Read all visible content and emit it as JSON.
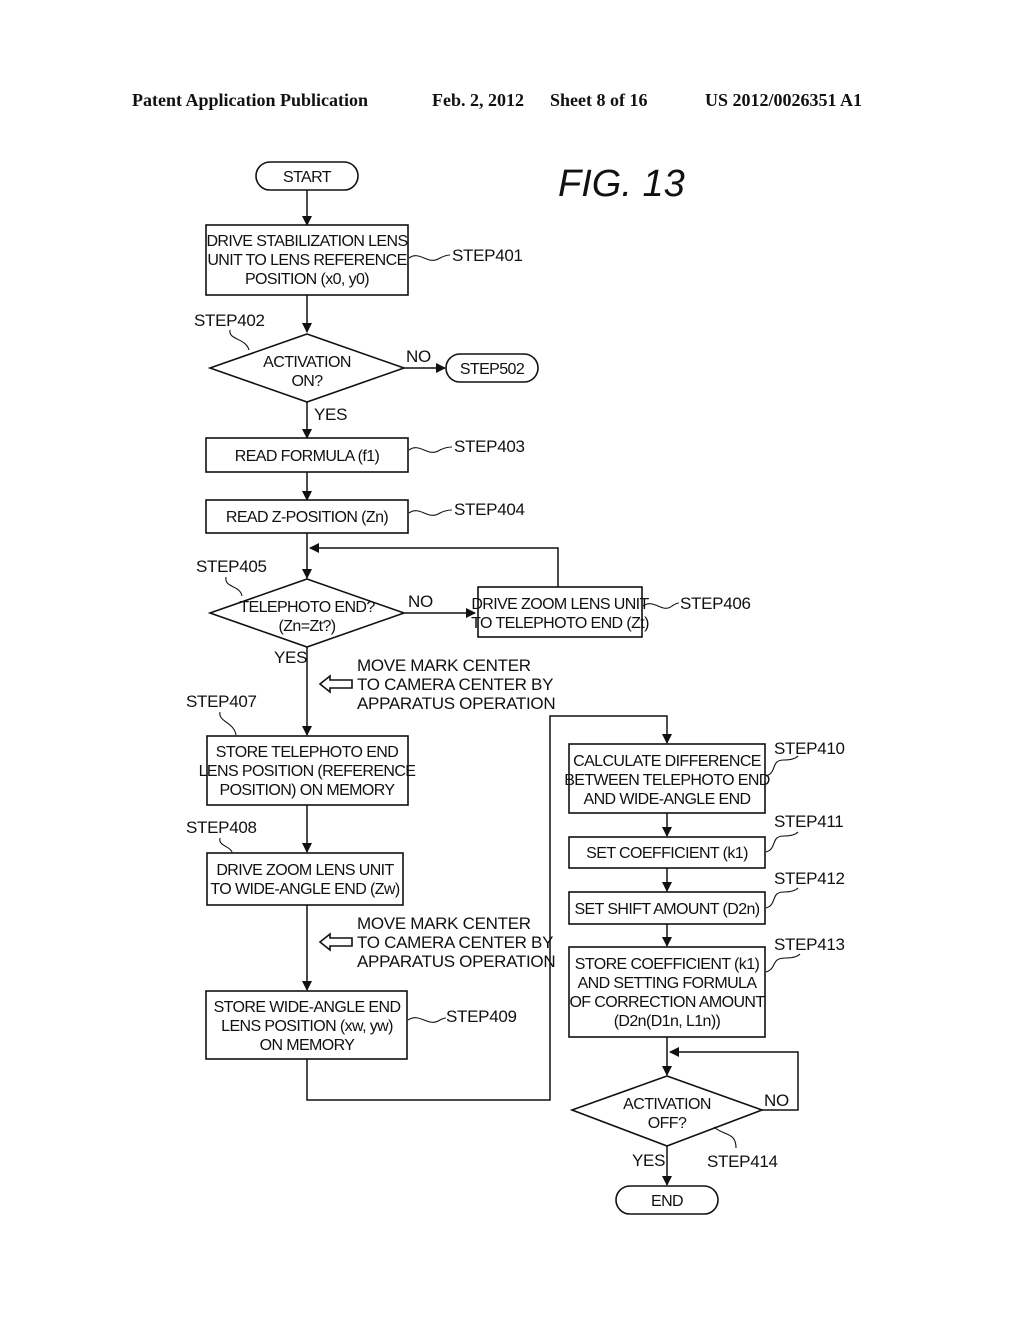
{
  "header": {
    "publication": "Patent Application Publication",
    "date": "Feb. 2, 2012",
    "sheet": "Sheet 8 of 16",
    "number": "US 2012/0026351 A1"
  },
  "figure": {
    "title": "FIG.  13"
  },
  "nodes": {
    "start": {
      "type": "terminal",
      "lines": [
        "START"
      ]
    },
    "s401": {
      "type": "process",
      "step": "STEP401",
      "lines": [
        "DRIVE STABILIZATION LENS",
        "UNIT TO LENS REFERENCE",
        "POSITION (x0, y0)"
      ]
    },
    "s402": {
      "type": "decision",
      "step": "STEP402",
      "lines": [
        "ACTIVATION",
        "ON?"
      ]
    },
    "s502": {
      "type": "terminal",
      "lines": [
        "STEP502"
      ]
    },
    "s403": {
      "type": "process",
      "step": "STEP403",
      "lines": [
        "READ FORMULA (f1)"
      ]
    },
    "s404": {
      "type": "process",
      "step": "STEP404",
      "lines": [
        "READ Z-POSITION (Zn)"
      ]
    },
    "s405": {
      "type": "decision",
      "step": "STEP405",
      "lines": [
        "TELEPHOTO END?",
        "(Zn=Zt?)"
      ]
    },
    "s406": {
      "type": "process",
      "step": "STEP406",
      "lines": [
        "DRIVE ZOOM LENS UNIT",
        "TO TELEPHOTO END (Zt)"
      ]
    },
    "s407": {
      "type": "process",
      "step": "STEP407",
      "lines": [
        "STORE TELEPHOTO END",
        "LENS POSITION (REFERENCE",
        "POSITION) ON MEMORY"
      ]
    },
    "s408": {
      "type": "process",
      "step": "STEP408",
      "lines": [
        "DRIVE ZOOM LENS UNIT",
        "TO WIDE-ANGLE END (Zw)"
      ]
    },
    "s409": {
      "type": "process",
      "step": "STEP409",
      "lines": [
        "STORE WIDE-ANGLE END",
        "LENS POSITION (xw, yw)",
        "ON MEMORY"
      ]
    },
    "s410": {
      "type": "process",
      "step": "STEP410",
      "lines": [
        "CALCULATE DIFFERENCE",
        "BETWEEN TELEPHOTO END",
        "AND WIDE-ANGLE END"
      ]
    },
    "s411": {
      "type": "process",
      "step": "STEP411",
      "lines": [
        "SET COEFFICIENT (k1)"
      ]
    },
    "s412": {
      "type": "process",
      "step": "STEP412",
      "lines": [
        "SET SHIFT AMOUNT (D2n)"
      ]
    },
    "s413": {
      "type": "process",
      "step": "STEP413",
      "lines": [
        "STORE COEFFICIENT (k1)",
        "AND SETTING FORMULA",
        "OF CORRECTION AMOUNT",
        "(D2n(D1n, L1n))"
      ]
    },
    "s414": {
      "type": "decision",
      "step": "STEP414",
      "lines": [
        "ACTIVATION",
        "OFF?"
      ]
    },
    "end": {
      "type": "terminal",
      "lines": [
        "END"
      ]
    }
  },
  "branch_labels": {
    "s402_no": "NO",
    "s402_yes": "YES",
    "s405_no": "NO",
    "s405_yes": "YES",
    "s414_no": "NO",
    "s414_yes": "YES"
  },
  "notes": {
    "note1": [
      "MOVE MARK CENTER",
      "TO CAMERA CENTER BY",
      "APPARATUS OPERATION"
    ],
    "note2": [
      "MOVE MARK CENTER",
      "TO CAMERA CENTER BY",
      "APPARATUS OPERATION"
    ]
  },
  "edges": [
    {
      "from": "start",
      "to": "s401"
    },
    {
      "from": "s401",
      "to": "s402"
    },
    {
      "from": "s402",
      "to": "s502",
      "label": "NO"
    },
    {
      "from": "s402",
      "to": "s403",
      "label": "YES"
    },
    {
      "from": "s403",
      "to": "s404"
    },
    {
      "from": "s404",
      "to": "s405"
    },
    {
      "from": "s405",
      "to": "s406",
      "label": "NO"
    },
    {
      "from": "s406",
      "to": "s405"
    },
    {
      "from": "s405",
      "to": "s407",
      "label": "YES"
    },
    {
      "from": "s407",
      "to": "s408"
    },
    {
      "from": "s408",
      "to": "s409"
    },
    {
      "from": "s409",
      "to": "s410"
    },
    {
      "from": "s410",
      "to": "s411"
    },
    {
      "from": "s411",
      "to": "s412"
    },
    {
      "from": "s412",
      "to": "s413"
    },
    {
      "from": "s413",
      "to": "s414"
    },
    {
      "from": "s414",
      "to": "s414",
      "label": "NO"
    },
    {
      "from": "s414",
      "to": "end",
      "label": "YES"
    }
  ]
}
